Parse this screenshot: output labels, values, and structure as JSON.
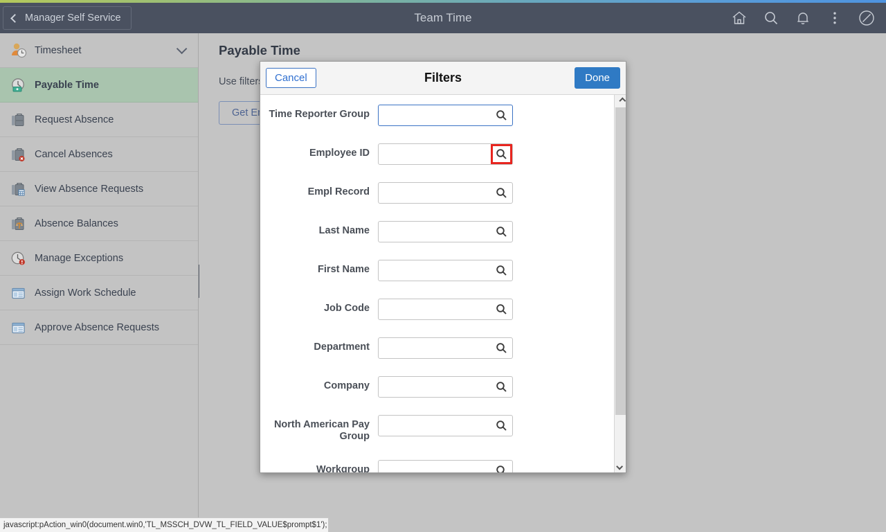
{
  "header": {
    "back_label": "Manager Self Service",
    "title": "Team Time",
    "icons": [
      {
        "name": "home-icon",
        "label": "Home"
      },
      {
        "name": "search-icon",
        "label": "Search"
      },
      {
        "name": "notifications-bell-icon",
        "label": "Notifications"
      },
      {
        "name": "actions-menu-icon",
        "label": "Actions"
      },
      {
        "name": "navbar-compass-icon",
        "label": "NavBar"
      }
    ]
  },
  "sidebar": {
    "items": [
      {
        "label": "Timesheet",
        "icon": "timesheet-person-clock-icon",
        "selected": false,
        "expandable": true
      },
      {
        "label": "Payable Time",
        "icon": "payable-time-clock-money-icon",
        "selected": true,
        "expandable": false
      },
      {
        "label": "Request Absence",
        "icon": "briefcase-icon",
        "selected": false,
        "expandable": false
      },
      {
        "label": "Cancel Absences",
        "icon": "briefcase-cancel-icon",
        "selected": false,
        "expandable": false
      },
      {
        "label": "View Absence Requests",
        "icon": "briefcase-calendar-icon",
        "selected": false,
        "expandable": false
      },
      {
        "label": "Absence Balances",
        "icon": "briefcase-balance-icon",
        "selected": false,
        "expandable": false
      },
      {
        "label": "Manage Exceptions",
        "icon": "clock-alert-icon",
        "selected": false,
        "expandable": false
      },
      {
        "label": "Assign Work Schedule",
        "icon": "window-panel-icon",
        "selected": false,
        "expandable": false
      },
      {
        "label": "Approve Absence Requests",
        "icon": "window-panel-icon",
        "selected": false,
        "expandable": false
      }
    ],
    "collapse_handle": "collapse-sidebar-handle"
  },
  "main": {
    "page_title": "Payable Time",
    "description": "Use filters to select time. Click Done to close Search Options.",
    "get_button_label": "Get Employees"
  },
  "modal": {
    "title": "Filters",
    "cancel_label": "Cancel",
    "done_label": "Done",
    "fields": [
      {
        "label": "Time Reporter Group",
        "value": "",
        "placeholder": "",
        "focused": true,
        "lookup_highlighted": false
      },
      {
        "label": "Employee ID",
        "value": "",
        "placeholder": "",
        "focused": false,
        "lookup_highlighted": true
      },
      {
        "label": "Empl Record",
        "value": "",
        "placeholder": "",
        "focused": false,
        "lookup_highlighted": false
      },
      {
        "label": "Last Name",
        "value": "",
        "placeholder": "",
        "focused": false,
        "lookup_highlighted": false
      },
      {
        "label": "First Name",
        "value": "",
        "placeholder": "",
        "focused": false,
        "lookup_highlighted": false
      },
      {
        "label": "Job Code",
        "value": "",
        "placeholder": "",
        "focused": false,
        "lookup_highlighted": false
      },
      {
        "label": "Department",
        "value": "",
        "placeholder": "",
        "focused": false,
        "lookup_highlighted": false
      },
      {
        "label": "Company",
        "value": "",
        "placeholder": "",
        "focused": false,
        "lookup_highlighted": false
      },
      {
        "label": "North American Pay Group",
        "value": "",
        "placeholder": "",
        "focused": false,
        "lookup_highlighted": false
      },
      {
        "label": "Workgroup",
        "value": "",
        "placeholder": "",
        "focused": false,
        "lookup_highlighted": false
      }
    ]
  },
  "statusbar": {
    "text": "javascript:pAction_win0(document.win0,'TL_MSSCH_DVW_TL_FIELD_VALUE$prompt$1');"
  },
  "colors": {
    "header_bg": "#4a5160",
    "sidebar_bg": "#c3c3c3",
    "sidebar_selected": "#a9c4ae",
    "accent_blue": "#2f7ac4",
    "highlight_red": "#e8251f",
    "page_bg": "#c4c4c4"
  }
}
